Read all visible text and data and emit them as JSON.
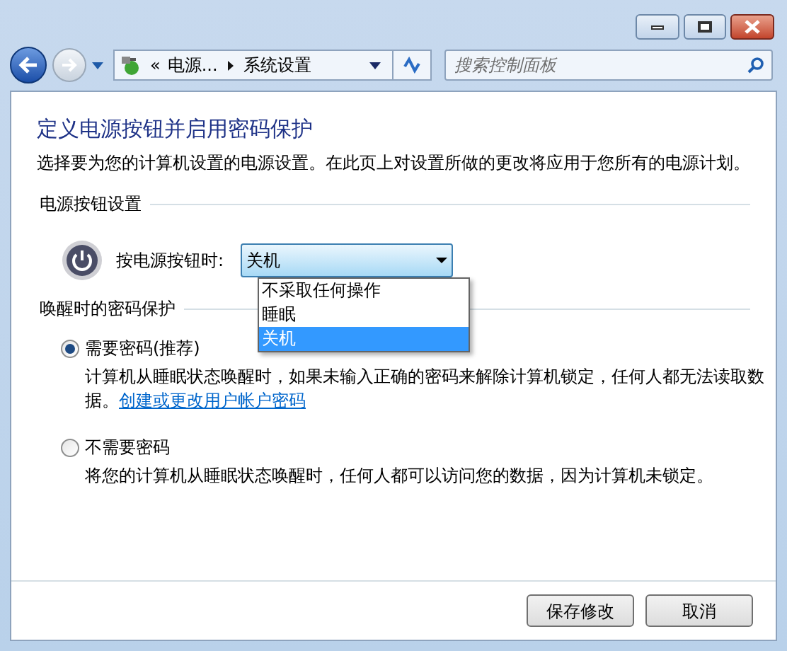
{
  "address_bar": {
    "overflow": "«",
    "path": [
      "电源...",
      "系统设置"
    ]
  },
  "search": {
    "placeholder": "搜索控制面板"
  },
  "heading": "定义电源按钮并启用密码保护",
  "description": "选择要为您的计算机设置的电源设置。在此页上对设置所做的更改将应用于您所有的电源计划。",
  "power_section": {
    "title": "电源按钮设置",
    "label": "按电源按钮时:",
    "value": "关机",
    "expanded": true,
    "options": [
      {
        "label": "不采取任何操作",
        "selected": false
      },
      {
        "label": "睡眠",
        "selected": false
      },
      {
        "label": "关机",
        "selected": true
      }
    ]
  },
  "password_section": {
    "title": "唤醒时的密码保护",
    "options": [
      {
        "label": "需要密码(推荐)",
        "selected": true,
        "description": "计算机从睡眠状态唤醒时，如果未输入正确的密码来解除计算机锁定，任何人都无法读取数据。",
        "link": "创建或更改用户帐户密码"
      },
      {
        "label": "不需要密码",
        "selected": false,
        "description": "将您的计算机从睡眠状态唤醒时，任何人都可以访问您的数据，因为计算机未锁定。"
      }
    ]
  },
  "buttons": [
    "保存修改",
    "取消"
  ]
}
